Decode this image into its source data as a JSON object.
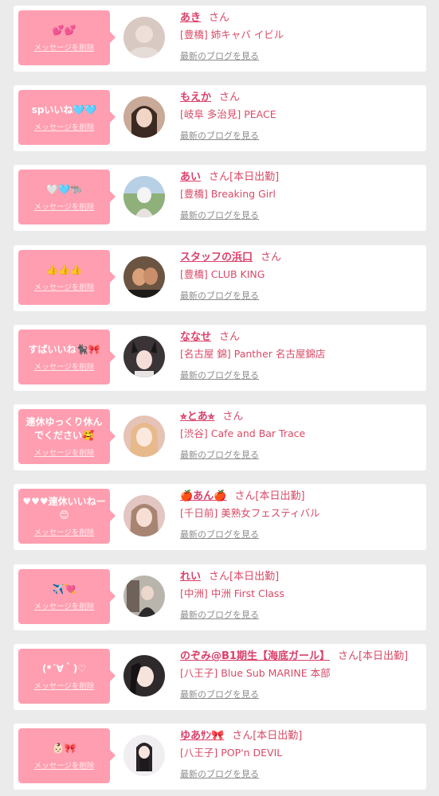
{
  "items": [
    {
      "message": "💕💕",
      "delete_label": "メッセージを削除",
      "name": "あき",
      "honorific": "さん",
      "status": "",
      "area": "[豊橋]",
      "shop": "姉キャバ イビル",
      "blog_label": "最新のブログを見る",
      "avatar_color": "#d8c9c2"
    },
    {
      "message": "spいいね🩵🩵",
      "delete_label": "メッセージを削除",
      "name": "もえか",
      "honorific": "さん",
      "status": "",
      "area": "[岐阜 多治見]",
      "shop": "PEACE",
      "blog_label": "最新のブログを見る",
      "avatar_color": "#c9a997"
    },
    {
      "message": "🤍🩵🐃",
      "delete_label": "メッセージを削除",
      "name": "あい",
      "honorific": "さん",
      "status": "[本日出勤]",
      "area": "[豊橋]",
      "shop": "Breaking Girl",
      "blog_label": "最新のブログを見る",
      "avatar_color": "#8fb07a"
    },
    {
      "message": "👍👍👍",
      "delete_label": "メッセージを削除",
      "name": "スタッフの浜口",
      "honorific": "さん",
      "status": "",
      "area": "[豊橋]",
      "shop": "CLUB KING",
      "blog_label": "最新のブログを見る",
      "avatar_color": "#6b5442"
    },
    {
      "message": "すばいいね🐈‍⬛🎀",
      "delete_label": "メッセージを削除",
      "name": "ななせ",
      "honorific": "さん",
      "status": "",
      "area": "[名古屋 錦]",
      "shop": "Panther 名古屋錦店",
      "blog_label": "最新のブログを見る",
      "avatar_color": "#3a3436"
    },
    {
      "message": "連休ゆっくり休んでください🥰",
      "delete_label": "メッセージを削除",
      "name": "⭐︎とあ⭐︎",
      "honorific": "さん",
      "status": "",
      "area": "[渋谷]",
      "shop": "Cafe and Bar Trace",
      "blog_label": "最新のブログを見る",
      "avatar_color": "#e6c3b7"
    },
    {
      "message": "♥♥♥連休いいねー😊",
      "delete_label": "メッセージを削除",
      "name": "🍎あん🍎",
      "honorific": "さん",
      "status": "[本日出勤]",
      "area": "[千日前]",
      "shop": "美熟女フェスティバル",
      "blog_label": "最新のブログを見る",
      "avatar_color": "#e3c6c1"
    },
    {
      "message": "✈️💘",
      "delete_label": "メッセージを削除",
      "name": "れい",
      "honorific": "さん",
      "status": "[本日出勤]",
      "area": "[中洲]",
      "shop": "中洲 First Class",
      "blog_label": "最新のブログを見る",
      "avatar_color": "#b9b4ac"
    },
    {
      "message": "(*´∀｀)♡",
      "delete_label": "メッセージを削除",
      "name": "のぞみ@B1期生【海底ガール】",
      "honorific": "さん",
      "status": "[本日出勤]",
      "area": "[八王子]",
      "shop": "Blue Sub MARINE 本部",
      "blog_label": "最新のブログを見る",
      "avatar_color": "#2e2a2b"
    },
    {
      "message": "👶🏻🎀",
      "delete_label": "メッセージを削除",
      "name": "ゆあｻﾝ🎀",
      "honorific": "さん",
      "status": "[本日出勤]",
      "area": "[八王子]",
      "shop": "POP'n DEVIL",
      "blog_label": "最新のブログを見る",
      "avatar_color": "#f1eef2"
    }
  ]
}
